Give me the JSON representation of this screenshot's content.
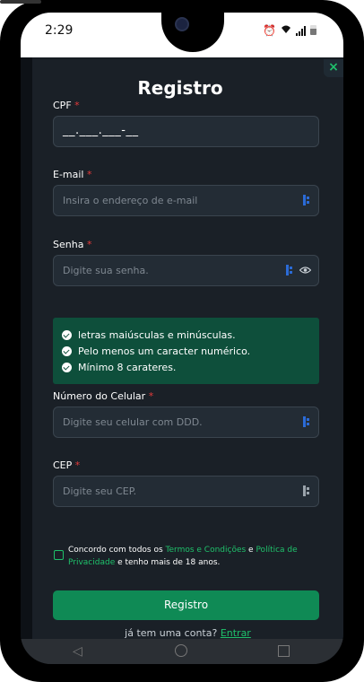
{
  "status_bar": {
    "time": "2:29",
    "icons": [
      "alarm-icon",
      "wifi-icon",
      "signal-icon",
      "battery-icon"
    ]
  },
  "modal": {
    "title": "Registro",
    "close_label": "×"
  },
  "fields": {
    "cpf": {
      "label": "CPF",
      "required_mark": "*",
      "value": "__.___.___-__"
    },
    "email": {
      "label": "E-mail",
      "required_mark": "*",
      "placeholder": "Insira o endereço de e-mail"
    },
    "password": {
      "label": "Senha",
      "required_mark": "*",
      "placeholder": "Digite sua senha."
    },
    "phone": {
      "label": "Número do Celular",
      "required_mark": "*",
      "placeholder": "Digite seu celular com DDD."
    },
    "cep": {
      "label": "CEP",
      "required_mark": "*",
      "placeholder": "Digite seu CEP."
    }
  },
  "password_rules": [
    "letras maiúsculas e minúsculas.",
    "Pelo menos um caracter numérico.",
    "Mínimo 8 carateres."
  ],
  "terms": {
    "prefix": "Concordo com todos os ",
    "terms_link": "Termos e Condições",
    "conjunction": " e ",
    "privacy_link": "Política de Privacidade",
    "suffix": " e tenho mais de 18 anos."
  },
  "submit_label": "Registro",
  "login_prompt": "já tem uma conta?",
  "login_link": "Entrar",
  "colors": {
    "accent": "#1fc16b",
    "modal_bg": "#1a2027",
    "rules_bg": "#0e4f3b",
    "button_bg": "#0f8a55",
    "required": "#e53a3a"
  }
}
